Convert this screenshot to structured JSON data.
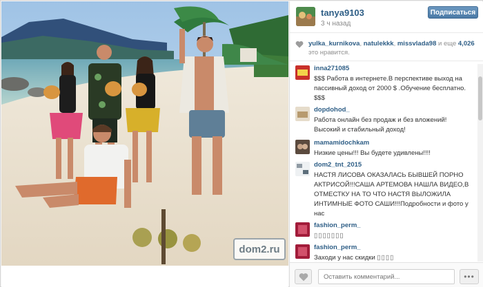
{
  "post": {
    "username": "tanya9103",
    "time_ago": "3 ч назад",
    "follow_label": "Подписаться",
    "watermark": "dom2.ru"
  },
  "likes": {
    "users": [
      "yulka_kurnikova",
      "natulekkk",
      "missvlada98"
    ],
    "sep1": ", ",
    "sep2": ", ",
    "and_more": " и еще ",
    "count": "4,026",
    "suffix": " это нравится."
  },
  "comments": [
    {
      "user": "inna271085",
      "text": "$$$ Работа в интернете.В перспективе выход на пассивный доход от 2000 $ .Обучение бесплатно. $$$",
      "avatar_color": "#c8302a"
    },
    {
      "user": "dopdohod_",
      "text": " Работа онлайн без продаж и без вложений! Высокий и стабильный доход!",
      "avatar_color": "#b79a6e"
    },
    {
      "user": "mamamidochkam",
      "text": "Низкие цены!!! Вы будете удивлены!!!!",
      "avatar_color": "#5b4a3e"
    },
    {
      "user": "dom2_tnt_2015",
      "text": "НАСТЯ ЛИСОВА ОКАЗАЛАСЬ БЫВШЕЙ ПОРНО АКТРИСОЙ!!!САША АРТЕМОВА НАШЛА ВИДЕО,В ОТМЕСТКУ НА ТО ЧТО НАСТЯ ВЫЛОЖИЛА ИНТИМНЫЕ ФОТО САШИ!!!Подробности и фото у нас",
      "avatar_color": "#8f9aa3"
    },
    {
      "user": "fashion_perm_",
      "text": "",
      "avatar_color": "#a21c3a"
    },
    {
      "user": "fashion_perm_",
      "text": "Заходи у нас скидки ",
      "avatar_color": "#a21c3a"
    }
  ],
  "footer": {
    "comment_placeholder": "Оставить комментарий...",
    "more_label": "•••"
  },
  "icons": {
    "heart": "heart-icon",
    "more": "ellipsis-icon"
  }
}
